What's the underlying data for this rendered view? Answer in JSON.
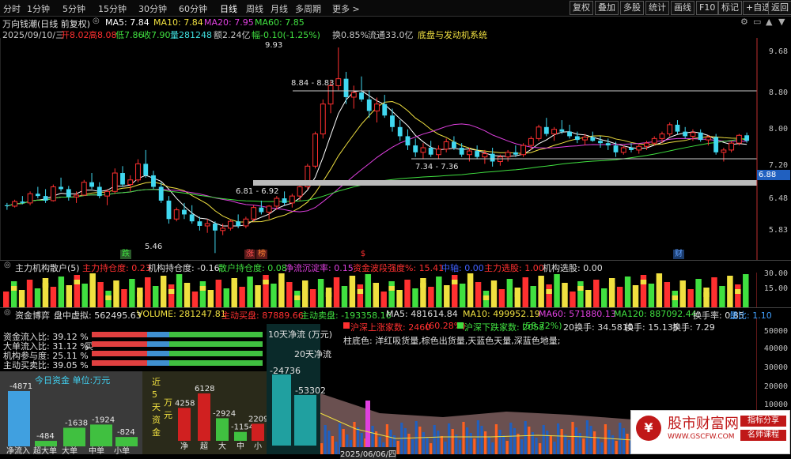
{
  "toolbar": {
    "periods": [
      "分时",
      "1分钟",
      "5分钟",
      "15分钟",
      "30分钟",
      "60分钟",
      "日线",
      "周线",
      "月线",
      "多周期",
      "更多 >"
    ],
    "active": "日线",
    "right_buttons": [
      "复权",
      "叠加",
      "多股",
      "统计",
      "画线",
      "F10",
      "标记",
      "+自选",
      "返回"
    ]
  },
  "header": {
    "title": "万向钱潮(日线 前复权)",
    "ma": [
      {
        "label": "MA5: 7.84",
        "color": "#ffffff"
      },
      {
        "label": "MA10: 7.84",
        "color": "#f0e040"
      },
      {
        "label": "MA20: 7.95",
        "color": "#e040e0"
      },
      {
        "label": "MA60: 7.85",
        "color": "#40e040"
      }
    ],
    "line2": {
      "date": "2025/09/10/三",
      "open": "开8.02",
      "high": "高8.08",
      "low": "低7.86",
      "close": "收7.90",
      "vol": "量281248",
      "amt": "额2.24亿",
      "chg": "幅-0.10(-1.25%)",
      "turnover": "换0.85%",
      "float": "流通33.0亿",
      "indicator": "底盘与发动机系统"
    }
  },
  "price_panel": {
    "y_labels": [
      "9.68",
      "8.80",
      "8.00",
      "7.20",
      "6.48",
      "5.83"
    ],
    "annotations": {
      "high": "9.93",
      "range1": "8.84 - 8.83",
      "range2": "7.34 - 7.36",
      "range3": "6.81 - 6.92",
      "low": "5.46",
      "price_tag": "6.88"
    },
    "markers": [
      "跌",
      "涨",
      "榜",
      "$",
      "财"
    ],
    "up_color": "#ff3030",
    "down_color": "#40d8f0"
  },
  "chart_data": {
    "type": "candlestick",
    "ylim": [
      5.5,
      10.0
    ],
    "candles": [
      [
        6.5,
        6.55,
        6.4,
        6.48
      ],
      [
        6.48,
        6.62,
        6.45,
        6.58
      ],
      [
        6.58,
        6.7,
        6.52,
        6.55
      ],
      [
        6.55,
        6.8,
        6.5,
        6.75
      ],
      [
        6.75,
        6.9,
        6.65,
        6.7
      ],
      [
        6.7,
        6.85,
        6.55,
        6.6
      ],
      [
        6.6,
        6.95,
        6.58,
        6.9
      ],
      [
        6.9,
        7.1,
        6.8,
        6.85
      ],
      [
        6.85,
        6.92,
        6.6,
        6.68
      ],
      [
        6.68,
        6.8,
        6.55,
        6.72
      ],
      [
        6.72,
        7.05,
        6.7,
        7.0
      ],
      [
        7.0,
        7.2,
        6.85,
        6.9
      ],
      [
        6.9,
        7.0,
        6.65,
        6.7
      ],
      [
        6.7,
        6.85,
        6.5,
        6.8
      ],
      [
        6.8,
        7.3,
        6.75,
        7.2
      ],
      [
        7.2,
        7.35,
        6.9,
        6.95
      ],
      [
        6.95,
        7.15,
        6.8,
        7.05
      ],
      [
        7.05,
        7.5,
        7.0,
        7.4
      ],
      [
        7.4,
        7.7,
        7.1,
        7.15
      ],
      [
        7.15,
        7.25,
        6.85,
        6.9
      ],
      [
        6.9,
        7.0,
        6.55,
        6.6
      ],
      [
        6.6,
        6.7,
        6.1,
        6.2
      ],
      [
        6.2,
        6.45,
        6.15,
        6.4
      ],
      [
        6.4,
        6.55,
        6.2,
        6.3
      ],
      [
        6.3,
        6.5,
        6.1,
        6.15
      ],
      [
        6.15,
        6.25,
        5.95,
        6.05
      ],
      [
        6.05,
        6.2,
        5.9,
        6.1
      ],
      [
        6.1,
        6.15,
        5.46,
        5.95
      ],
      [
        5.95,
        6.1,
        5.85,
        6.0
      ],
      [
        6.0,
        6.2,
        5.95,
        6.15
      ],
      [
        6.15,
        6.3,
        6.0,
        6.05
      ],
      [
        6.05,
        6.25,
        6.0,
        6.2
      ],
      [
        6.2,
        6.5,
        6.15,
        6.45
      ],
      [
        6.45,
        6.6,
        6.3,
        6.35
      ],
      [
        6.35,
        6.5,
        6.2,
        6.48
      ],
      [
        6.48,
        6.7,
        6.4,
        6.65
      ],
      [
        6.65,
        6.8,
        6.5,
        6.55
      ],
      [
        6.55,
        6.75,
        6.45,
        6.7
      ],
      [
        6.7,
        6.95,
        6.6,
        6.9
      ],
      [
        6.9,
        7.4,
        6.85,
        7.35
      ],
      [
        7.35,
        8.1,
        7.3,
        8.05
      ],
      [
        8.05,
        8.8,
        7.95,
        8.7
      ],
      [
        8.7,
        9.2,
        8.5,
        9.1
      ],
      [
        9.1,
        9.93,
        9.0,
        9.25
      ],
      [
        9.25,
        9.4,
        8.7,
        8.85
      ],
      [
        8.85,
        9.1,
        8.6,
        8.95
      ],
      [
        8.95,
        9.3,
        8.75,
        8.8
      ],
      [
        8.8,
        9.0,
        8.4,
        8.55
      ],
      [
        8.55,
        8.84,
        8.3,
        8.7
      ],
      [
        8.7,
        8.9,
        8.4,
        8.45
      ],
      [
        8.45,
        8.6,
        8.1,
        8.2
      ],
      [
        8.2,
        8.35,
        7.9,
        8.0
      ],
      [
        8.0,
        8.15,
        7.7,
        7.8
      ],
      [
        7.8,
        7.95,
        7.55,
        7.65
      ],
      [
        7.65,
        7.85,
        7.5,
        7.75
      ],
      [
        7.75,
        7.9,
        7.55,
        7.6
      ],
      [
        7.6,
        7.8,
        7.5,
        7.72
      ],
      [
        7.72,
        7.95,
        7.65,
        7.88
      ],
      [
        7.88,
        8.0,
        7.7,
        7.75
      ],
      [
        7.75,
        7.85,
        7.55,
        7.6
      ],
      [
        7.6,
        7.75,
        7.45,
        7.68
      ],
      [
        7.68,
        7.8,
        7.5,
        7.55
      ],
      [
        7.55,
        7.7,
        7.4,
        7.62
      ],
      [
        7.62,
        7.75,
        7.34,
        7.45
      ],
      [
        7.45,
        7.6,
        7.36,
        7.55
      ],
      [
        7.55,
        7.7,
        7.45,
        7.65
      ],
      [
        7.65,
        7.8,
        7.55,
        7.6
      ],
      [
        7.6,
        7.85,
        7.55,
        7.8
      ],
      [
        7.8,
        8.0,
        7.7,
        7.95
      ],
      [
        7.95,
        8.25,
        7.9,
        8.2
      ],
      [
        8.2,
        8.4,
        8.0,
        8.05
      ],
      [
        8.05,
        8.2,
        7.9,
        8.15
      ],
      [
        8.15,
        8.35,
        8.05,
        8.1
      ],
      [
        8.1,
        8.25,
        7.95,
        8.0
      ],
      [
        8.0,
        8.1,
        7.85,
        7.92
      ],
      [
        7.92,
        8.05,
        7.8,
        7.98
      ],
      [
        7.98,
        8.1,
        7.88,
        7.9
      ],
      [
        7.9,
        8.0,
        7.75,
        7.85
      ],
      [
        7.85,
        7.95,
        7.7,
        7.8
      ],
      [
        7.8,
        7.88,
        7.55,
        7.65
      ],
      [
        7.65,
        7.8,
        7.6,
        7.75
      ],
      [
        7.75,
        7.85,
        7.65,
        7.7
      ],
      [
        7.7,
        7.82,
        7.62,
        7.78
      ],
      [
        7.78,
        7.9,
        7.7,
        7.85
      ],
      [
        7.85,
        8.0,
        7.8,
        7.95
      ],
      [
        7.95,
        8.1,
        7.85,
        8.05
      ],
      [
        8.05,
        8.3,
        8.0,
        8.25
      ],
      [
        8.25,
        8.35,
        8.05,
        8.1
      ],
      [
        8.1,
        8.2,
        7.95,
        8.0
      ],
      [
        8.0,
        8.15,
        7.9,
        8.08
      ],
      [
        8.08,
        8.15,
        7.88,
        7.92
      ],
      [
        7.92,
        8.02,
        7.8,
        7.98
      ],
      [
        7.98,
        8.05,
        7.6,
        7.65
      ],
      [
        7.65,
        7.75,
        7.45,
        7.7
      ],
      [
        7.7,
        7.9,
        7.65,
        7.85
      ],
      [
        7.85,
        8.05,
        7.8,
        8.02
      ],
      [
        8.02,
        8.08,
        7.86,
        7.9
      ]
    ]
  },
  "indicator_panel": {
    "title": "主力机构散户(5)",
    "items": [
      {
        "label": "主力持仓度: 0.23",
        "color": "#ff3030"
      },
      {
        "label": "机构持仓度: -0.16",
        "color": "#e0e0e0"
      },
      {
        "label": "散户持仓度: 0.08",
        "color": "#40e040"
      },
      {
        "label": "净流沉淀率: 0.15",
        "color": "#e040e0"
      },
      {
        "label": "资金波段强度%: 15.41",
        "color": "#ff3030"
      },
      {
        "label": "中轴: 0.00",
        "color": "#4060ff"
      },
      {
        "label": "主力选股: 1.00",
        "color": "#ff3030"
      },
      {
        "label": "机构选股: 0.00",
        "color": "#e0e0e0"
      }
    ],
    "y_labels": [
      "30.00",
      "15.00"
    ]
  },
  "fund_panel": {
    "title": "资金博弈",
    "items": [
      {
        "label": "盘中虚拟: 562495.63",
        "color": "#e0e0e0"
      },
      {
        "label": "VOLUME: 281247.81",
        "color": "#f0e040"
      },
      {
        "label": "主动买盘: 87889.66",
        "color": "#ff3030"
      },
      {
        "label": "主动卖盘: -193358.16",
        "color": "#40e040"
      },
      {
        "label": "MA5: 481614.84",
        "color": "#e0e0e0"
      },
      {
        "label": "MA10: 499952.19",
        "color": "#f0e040"
      },
      {
        "label": "MA60: 571880.13",
        "color": "#e040e0"
      },
      {
        "label": "MA120: 887092.44",
        "color": "#40e040"
      },
      {
        "label": "换手率: 0.85",
        "color": "#e0e0e0"
      },
      {
        "label": "量比: 1.10",
        "color": "#40a0ff"
      }
    ],
    "ratios": [
      {
        "label": "资金流入比: 39.12 %",
        "value": 39.12
      },
      {
        "label": "大单流入比: 31.12 %",
        "value": 31.12
      },
      {
        "label": "机构参与度: 25.11 %",
        "value": 25.11
      },
      {
        "label": "主动买卖比: 39.05 %",
        "value": 39.05
      }
    ],
    "ratio_suffix": "买",
    "today_title": "今日资金 单位:万元",
    "today_bars": [
      {
        "label": "净流入",
        "value": -4871
      },
      {
        "label": "超大单",
        "value": -484
      },
      {
        "label": "大单",
        "value": -1638
      },
      {
        "label": "中单",
        "value": -1924
      },
      {
        "label": "小单",
        "value": -824
      }
    ],
    "five_day_title": [
      "近",
      "5",
      "天",
      "资",
      "金"
    ],
    "five_day_unit": [
      "万",
      "元"
    ],
    "five_day_bars": [
      {
        "label": "净",
        "value": 4258
      },
      {
        "label": "超",
        "value": 6128
      },
      {
        "label": "大",
        "value": -2924
      },
      {
        "label": "中",
        "value": -1154
      },
      {
        "label": "小",
        "value": 2209
      }
    ],
    "ten_day_title": "10天净流 (万元)",
    "ten_day_values": [
      "-24736",
      "-53302"
    ],
    "twenty_day_title": "20天净流",
    "stats": [
      {
        "label": "沪深上涨家数: 2460",
        "color": "#ff3030"
      },
      {
        "label": "(60.28%)",
        "color": "#ff3030"
      },
      {
        "label": "沪深下跌家数: 2058",
        "color": "#40e040"
      },
      {
        "label": "(58.72%)",
        "color": "#40e040"
      },
      {
        "label": "20换手: 34.5810",
        "color": "#e0e0e0"
      },
      {
        "label": "换手: 15.135",
        "color": "#e0e0e0"
      },
      {
        "label": "换手: 7.29",
        "color": "#e0e0e0"
      }
    ],
    "legend_note": "柱底色: 洋红吸货量,棕色出货量,天蓝色天量,深蓝色地量;",
    "y_labels": [
      "50000",
      "40000",
      "30000",
      "20000",
      "10000"
    ],
    "date_tag": "2025/06/06/四"
  },
  "watermark": {
    "title": "股市财富网",
    "url": "WWW.GSCFW.COM",
    "btn1": "指标分享",
    "btn2": "名师课程"
  }
}
